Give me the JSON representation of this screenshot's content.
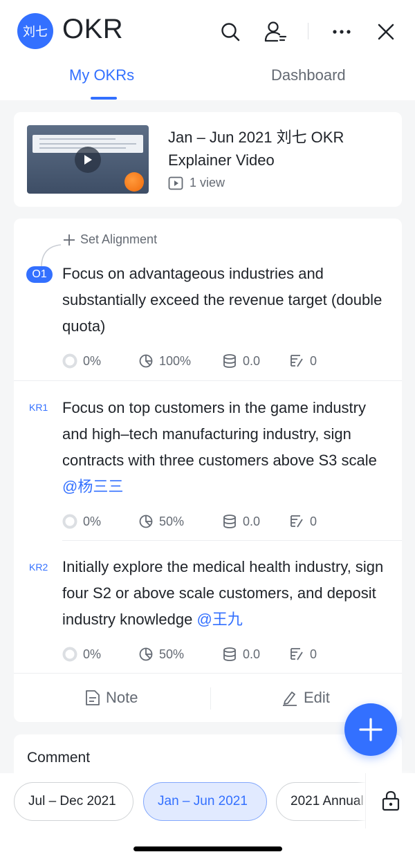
{
  "header": {
    "avatar_text": "刘七",
    "title": "OKR",
    "tabs": [
      {
        "label": "My OKRs",
        "active": true
      },
      {
        "label": "Dashboard",
        "active": false
      }
    ]
  },
  "video": {
    "title": "Jan – Jun 2021 刘七 OKR Explainer Video",
    "views": "1 view"
  },
  "objective": {
    "set_alignment": "Set Alignment",
    "badge": "O1",
    "text": "Focus on advantageous industries and substantially exceed the revenue target (double quota)",
    "stats": {
      "progress": "0%",
      "weight": "100%",
      "score": "0.0",
      "notes": "0"
    }
  },
  "key_results": [
    {
      "label": "KR1",
      "text": "Focus on top customers in the game industry and high–tech manufacturing industry, sign contracts with three customers above S3 scale",
      "mention": "@杨三三",
      "stats": {
        "progress": "0%",
        "weight": "50%",
        "score": "0.0",
        "notes": "0"
      }
    },
    {
      "label": "KR2",
      "text": "Initially explore the medical health industry, sign four S2 or above scale customers, and deposit industry knowledge",
      "mention": "@王九",
      "stats": {
        "progress": "0%",
        "weight": "50%",
        "score": "0.0",
        "notes": "0"
      }
    }
  ],
  "actions": {
    "note": "Note",
    "edit": "Edit"
  },
  "comment": {
    "title": "Comment"
  },
  "periods": [
    {
      "label": "Jul – Dec 2021",
      "active": false
    },
    {
      "label": "Jan – Jun 2021",
      "active": true
    },
    {
      "label": "2021 Annual",
      "active": false
    }
  ],
  "colors": {
    "accent": "#3370ff",
    "text": "#1f2329",
    "muted": "#646a73",
    "background": "#f5f6f7"
  }
}
